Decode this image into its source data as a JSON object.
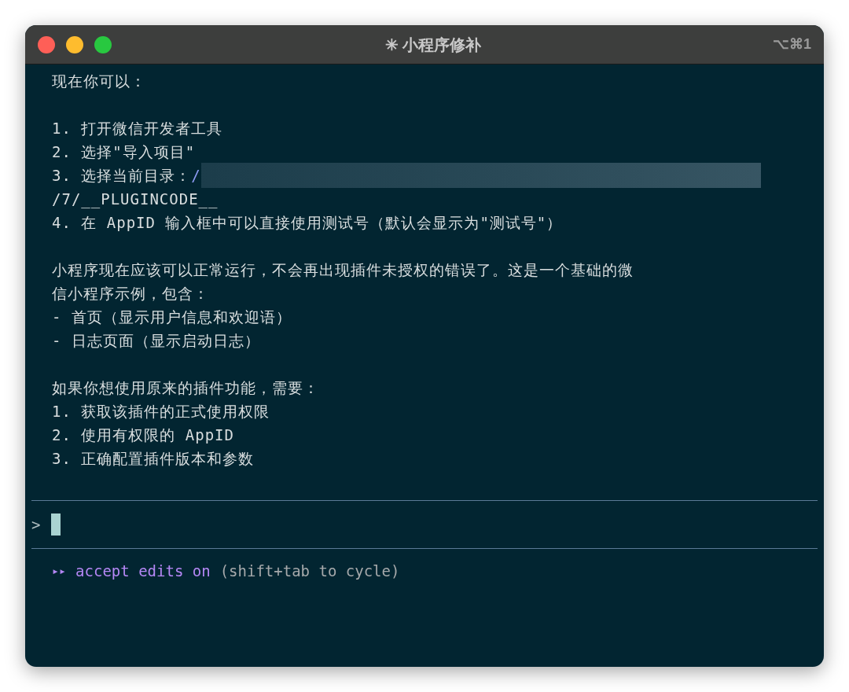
{
  "window": {
    "title": "✳ 小程序修补",
    "shortcut": "⌥⌘1"
  },
  "paragraphs": [
    [
      {
        "kind": "plain",
        "text": "现在你可以："
      }
    ],
    [
      {
        "kind": "plain",
        "text": "1. 打开微信开发者工具"
      },
      {
        "kind": "plain",
        "text": "2. 选择\"导入项目\""
      },
      {
        "kind": "redacted",
        "text": "3. 选择当前目录：",
        "path": "/"
      },
      {
        "kind": "plain",
        "text": "/7/__PLUGINCODE__"
      },
      {
        "kind": "plain",
        "text": "4. 在 AppID 输入框中可以直接使用测试号（默认会显示为\"测试号\"）"
      }
    ],
    [
      {
        "kind": "plain",
        "text": "小程序现在应该可以正常运行，不会再出现插件未授权的错误了。这是一个基础的微"
      },
      {
        "kind": "plain",
        "text": "信小程序示例，包含："
      },
      {
        "kind": "plain",
        "text": "- 首页（显示用户信息和欢迎语）"
      },
      {
        "kind": "plain",
        "text": "- 日志页面（显示启动日志）"
      }
    ],
    [
      {
        "kind": "plain",
        "text": "如果你想使用原来的插件功能，需要："
      },
      {
        "kind": "plain",
        "text": "1. 获取该插件的正式使用权限"
      },
      {
        "kind": "plain",
        "text": "2. 使用有权限的 AppID"
      },
      {
        "kind": "plain",
        "text": "3. 正确配置插件版本和参数"
      }
    ]
  ],
  "prompt": {
    "symbol": ">"
  },
  "status": {
    "marker": "▸▸",
    "mode": "accept edits on",
    "hint": "(shift+tab to cycle)"
  }
}
